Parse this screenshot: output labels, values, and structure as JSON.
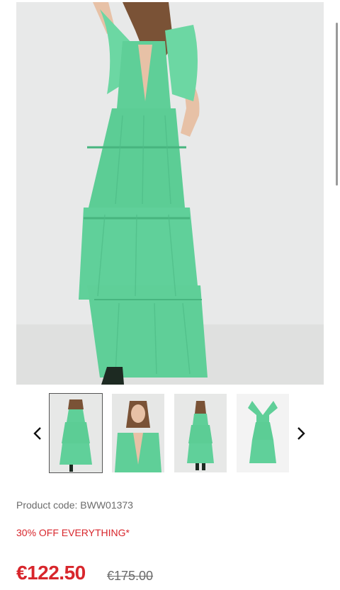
{
  "gallery": {
    "main_image_alt": "Green tiered tulle maxi dress",
    "thumbnails": [
      {
        "alt": "Front view"
      },
      {
        "alt": "Close-up view"
      },
      {
        "alt": "Back view"
      },
      {
        "alt": "Flat lay view"
      }
    ],
    "prev_icon": "chevron-left-icon",
    "next_icon": "chevron-right-icon"
  },
  "product": {
    "code_text": "Product code: BWW01373",
    "promo_text": "30% OFF EVERYTHING*",
    "price_now": "€122.50",
    "price_was": "€175.00"
  },
  "colors": {
    "dress": "#5fcf98",
    "sale": "#d8262c",
    "muted": "#6b6b6b"
  }
}
